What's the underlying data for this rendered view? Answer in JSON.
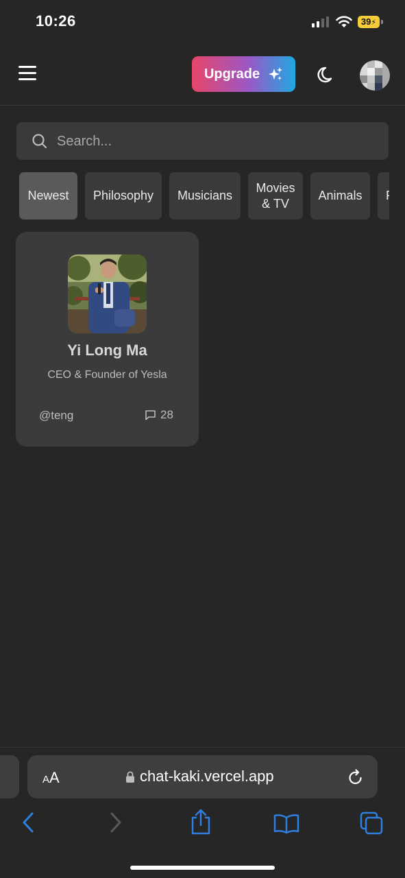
{
  "status_bar": {
    "time": "10:26",
    "battery": "39"
  },
  "header": {
    "menu_icon": "hamburger-menu-icon",
    "upgrade_label": "Upgrade",
    "upgrade_icon": "sparkles-icon",
    "theme_icon": "moon-icon",
    "upgrade_gradient": [
      "#e8456a",
      "#9b58c6",
      "#1fa8e2"
    ]
  },
  "search": {
    "placeholder": "Search...",
    "value": ""
  },
  "categories": [
    {
      "label": "Newest",
      "active": true
    },
    {
      "label": "Philosophy",
      "active": false
    },
    {
      "label": "Musicians",
      "active": false
    },
    {
      "label": "Movies\n& TV",
      "active": false
    },
    {
      "label": "Animals",
      "active": false
    },
    {
      "label": "F",
      "active": false
    }
  ],
  "cards": [
    {
      "name": "Yi Long Ma",
      "description": "CEO & Founder of Yesla",
      "handle": "@teng",
      "message_count": "28",
      "message_icon": "chat-bubble-icon"
    }
  ],
  "browser": {
    "text_size_label": "AA",
    "url": "chat-kaki.vercel.app",
    "accent_color": "#2f7fe0"
  }
}
